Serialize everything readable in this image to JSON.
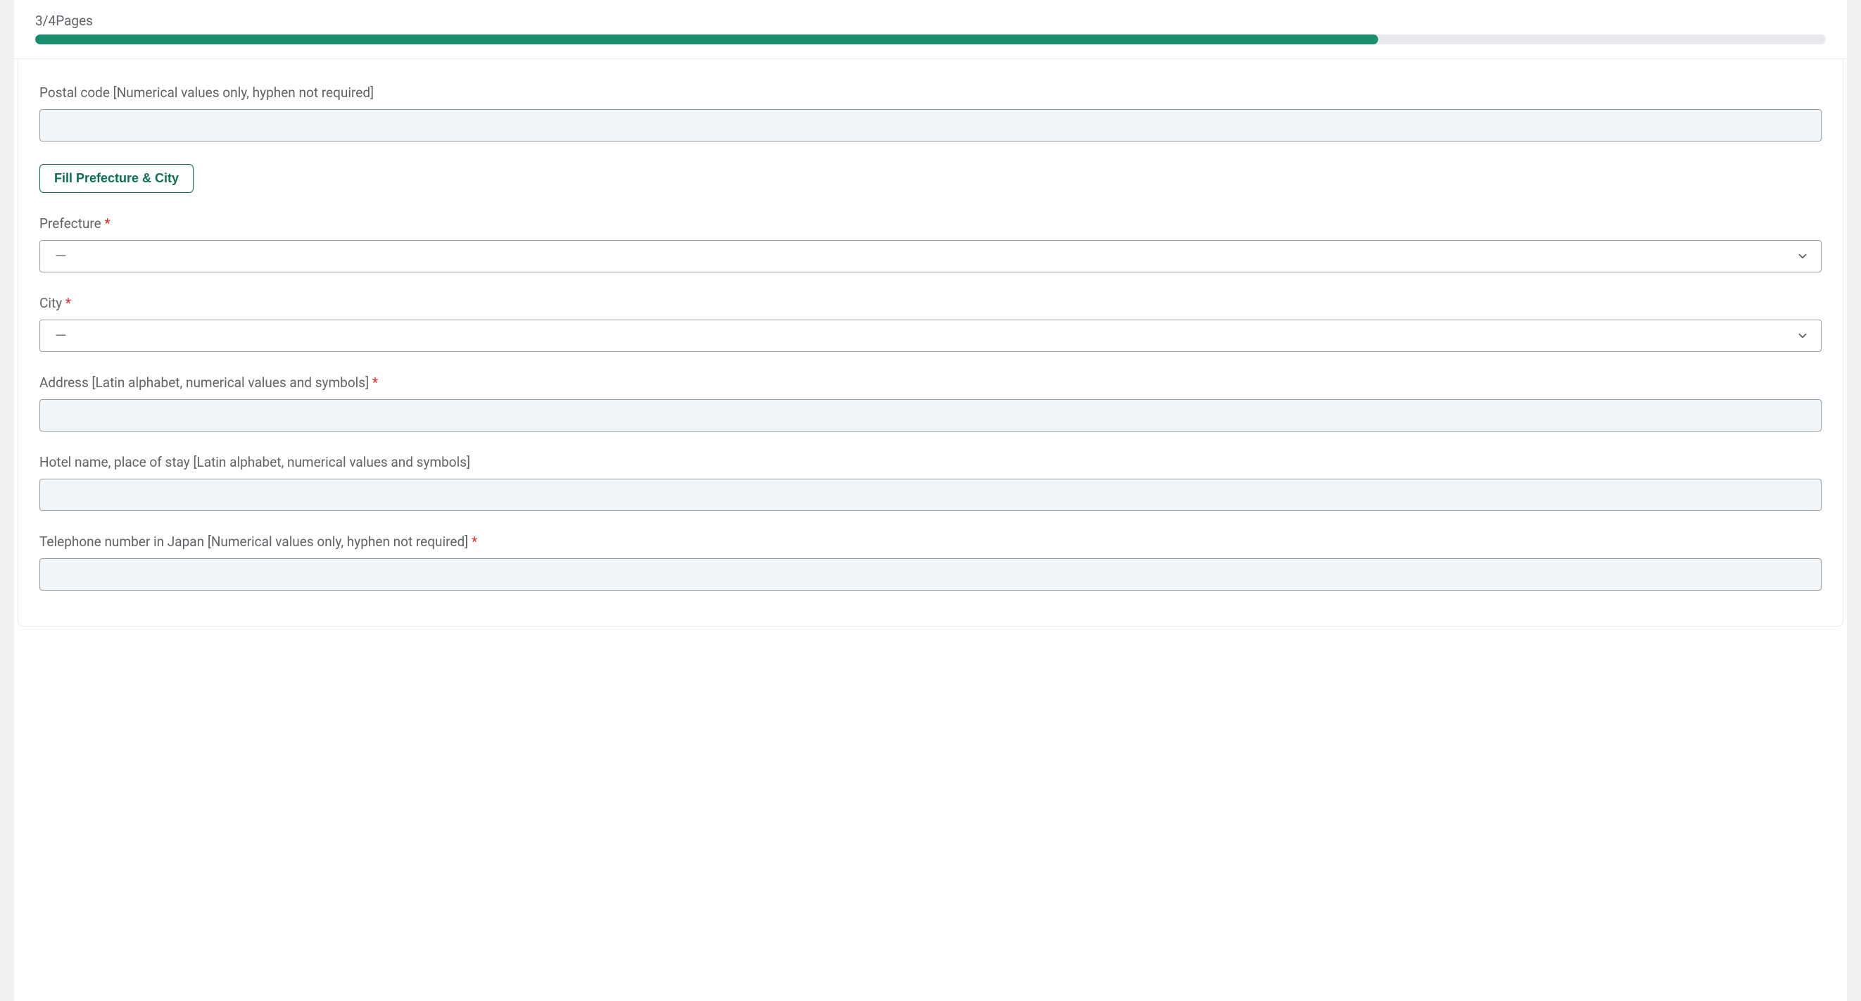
{
  "progress": {
    "label": "3/4Pages",
    "percent": 75
  },
  "form": {
    "postal_code": {
      "label": "Postal code [Numerical values only, hyphen not required]",
      "value": "",
      "required": false
    },
    "fill_button": {
      "label": "Fill Prefecture & City"
    },
    "prefecture": {
      "label": "Prefecture",
      "selected": "－",
      "required": true
    },
    "city": {
      "label": "City",
      "selected": "－",
      "required": true
    },
    "address": {
      "label": "Address [Latin alphabet, numerical values and symbols]",
      "value": "",
      "required": true
    },
    "hotel": {
      "label": "Hotel name, place of stay [Latin alphabet, numerical values and symbols]",
      "value": "",
      "required": false
    },
    "telephone": {
      "label": "Telephone number in Japan [Numerical values only, hyphen not required]",
      "value": "",
      "required": true
    },
    "required_mark": " *"
  }
}
